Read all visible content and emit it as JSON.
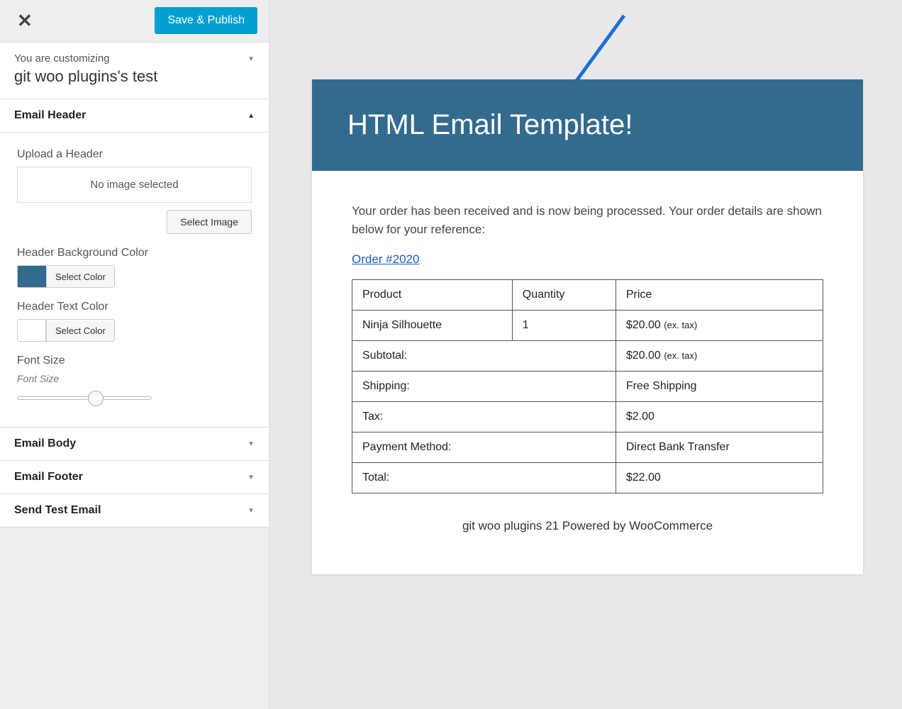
{
  "topbar": {
    "save_label": "Save & Publish"
  },
  "customizing": {
    "small": "You are customizing",
    "title": "git woo plugins's test"
  },
  "sections": {
    "email_header": {
      "title": "Email Header",
      "upload_label": "Upload a Header",
      "no_image": "No image selected",
      "select_image": "Select Image",
      "bg_label": "Header Background Color",
      "text_label": "Header Text Color",
      "select_color": "Select Color",
      "font_size_label": "Font Size",
      "font_size_sub": "Font Size",
      "colors": {
        "bg": "#336b8e",
        "text": "#ffffff"
      }
    },
    "email_body": "Email Body",
    "email_footer": "Email Footer",
    "send_test": "Send Test Email"
  },
  "email": {
    "header": "HTML Email Template!",
    "intro": "Your order has been received and is now being processed. Your order details are shown below for your reference:",
    "order_link": "Order #2020",
    "table": {
      "headers": {
        "product": "Product",
        "quantity": "Quantity",
        "price": "Price"
      },
      "item": {
        "product": "Ninja Silhouette",
        "quantity": "1",
        "price": "$20.00",
        "price_suffix": "(ex. tax)"
      },
      "rows": [
        {
          "label": "Subtotal:",
          "value": "$20.00",
          "suffix": "(ex. tax)"
        },
        {
          "label": "Shipping:",
          "value": "Free Shipping",
          "suffix": ""
        },
        {
          "label": "Tax:",
          "value": "$2.00",
          "suffix": ""
        },
        {
          "label": "Payment Method:",
          "value": "Direct Bank Transfer",
          "suffix": ""
        },
        {
          "label": "Total:",
          "value": "$22.00",
          "suffix": ""
        }
      ]
    },
    "footer": "git woo plugins 21 Powered by WooCommerce"
  }
}
